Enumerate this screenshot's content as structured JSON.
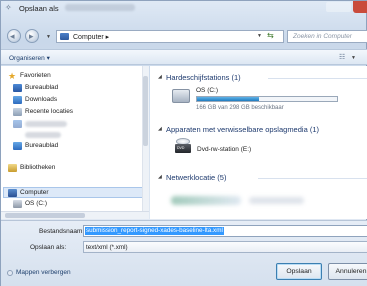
{
  "window": {
    "title": "Opslaan als"
  },
  "address": {
    "path": "Computer ▸",
    "search_placeholder": "Zoeken in Computer"
  },
  "toolbar": {
    "organize": "Organiseren ▾"
  },
  "navpane": {
    "favorites": "Favorieten",
    "desktop": "Bureaublad",
    "downloads": "Downloads",
    "recent": "Recente locaties",
    "desktop2": "Bureaublad",
    "libraries": "Bibliotheken",
    "computer": "Computer",
    "drive_c": "OS (C:)"
  },
  "content": {
    "groups": {
      "hard_drives": "Hardeschijfstations (1)",
      "removable": "Apparaten met verwisselbare opslagmedia (1)",
      "network": "Netwerklocatie (5)"
    },
    "drive_c": {
      "name": "OS (C:)",
      "space": "166 GB van 298 GB beschikbaar",
      "used_fraction": 0.44
    },
    "dvd": {
      "name": "Dvd-rw-station (E:)",
      "icon_label": "DVD"
    }
  },
  "form": {
    "filename_label": "Bestandsnaam:",
    "filename_value": "submission_report-signed-xades-baseline-lta.xml",
    "type_label": "Opslaan als:",
    "type_value": "text/xml (*.xml)"
  },
  "footer": {
    "hide_folders": "Mappen verbergen",
    "save": "Opslaan",
    "cancel": "Annuleren"
  },
  "colors": {
    "selection": "#3399ff",
    "drive_bar": "#1f7cc0",
    "close": "#c94b3b"
  }
}
